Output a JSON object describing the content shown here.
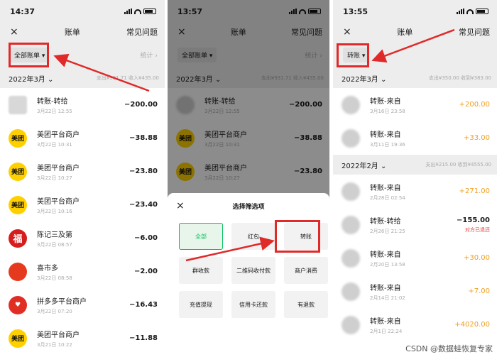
{
  "colors": {
    "accent_red": "#e02a2a",
    "wechat_green": "#07c160",
    "income_orange": "#f0a020"
  },
  "phone1": {
    "status_time": "14:37",
    "nav": {
      "close_icon": "×",
      "title": "账单",
      "faq": "常见问题"
    },
    "filter": {
      "label": "全部账单 ▾",
      "stats": "统计 ›"
    },
    "month": {
      "label": "2022年3月 ⌄",
      "summary": "支出¥931.71  收入¥435.00"
    },
    "rows": [
      {
        "icon": "blurred-avatar",
        "avatar_text": "",
        "name": "转账-转给",
        "date": "3月22日 12:55",
        "amount": "−200.00"
      },
      {
        "icon": "meituan-logo",
        "avatar_text": "美团",
        "name": "美团平台商户",
        "date": "3月22日 10:31",
        "amount": "−38.88"
      },
      {
        "icon": "meituan-logo",
        "avatar_text": "美团",
        "name": "美团平台商户",
        "date": "3月22日 10:27",
        "amount": "−23.80"
      },
      {
        "icon": "meituan-logo",
        "avatar_text": "美团",
        "name": "美团平台商户",
        "date": "3月22日 10:16",
        "amount": "−23.40"
      },
      {
        "icon": "fu-logo",
        "avatar_text": "福",
        "name": "陈记三及第",
        "date": "3月22日 08:57",
        "amount": "−6.00"
      },
      {
        "icon": "tomato-logo",
        "avatar_text": "",
        "name": "喜市多",
        "date": "3月22日 08:58",
        "amount": "−2.00"
      },
      {
        "icon": "pinduoduo-logo",
        "avatar_text": "♥",
        "name": "拼多多平台商户",
        "date": "3月22日 07:20",
        "amount": "−16.43"
      },
      {
        "icon": "meituan-logo",
        "avatar_text": "美团",
        "name": "美团平台商户",
        "date": "3月21日 10:22",
        "amount": "−11.88"
      }
    ]
  },
  "phone2": {
    "status_time": "13:57",
    "nav": {
      "close_icon": "×",
      "title": "账单",
      "faq": "常见问题"
    },
    "filter": {
      "label": "全部账单 ▾",
      "stats": "统计 ›"
    },
    "month": {
      "label": "2022年3月 ⌄",
      "summary": "支出¥931.71  收入¥435.00"
    },
    "rows": [
      {
        "icon": "person-avatar",
        "avatar_text": "",
        "name": "转账-转给",
        "date": "3月22日 12:55",
        "amount": "−200.00"
      },
      {
        "icon": "meituan-logo",
        "avatar_text": "美团",
        "name": "美团平台商户",
        "date": "3月22日 10:31",
        "amount": "−38.88"
      },
      {
        "icon": "meituan-logo",
        "avatar_text": "美团",
        "name": "美团平台商户",
        "date": "3月22日 10:27",
        "amount": "−23.80"
      }
    ],
    "sheet": {
      "close_icon": "×",
      "title": "选择筛选项",
      "options": [
        "全部",
        "红包",
        "转账",
        "群收款",
        "二维码收付款",
        "商户消费",
        "充值提现",
        "信用卡还款",
        "有退款"
      ]
    }
  },
  "phone3": {
    "status_time": "13:55",
    "nav": {
      "close_icon": "×",
      "title": "账单",
      "faq": "常见问题"
    },
    "filter": {
      "label": "转账 ▾"
    },
    "months": [
      {
        "label": "2022年3月 ⌄",
        "summary": "支出¥350.00  收到¥383.00",
        "rows": [
          {
            "name": "转账-来自",
            "date": "3月16日 23:58",
            "amount": "+200.00"
          },
          {
            "name": "转账-来自",
            "date": "3月11日 19:36",
            "amount": "+33.00"
          }
        ]
      },
      {
        "label": "2022年2月 ⌄",
        "summary": "支出¥215.00  收到¥4555.00",
        "rows": [
          {
            "name": "转账-来自",
            "date": "2月28日 02:54",
            "amount": "+271.00",
            "note": ""
          },
          {
            "name": "转账-转给",
            "date": "2月26日 21:25",
            "amount": "−155.00",
            "note": "对方已退还"
          },
          {
            "name": "转账-来自",
            "date": "2月20日 13:58",
            "amount": "+30.00",
            "note": ""
          },
          {
            "name": "转账-来自",
            "date": "2月14日 21:02",
            "amount": "+7.00",
            "note": ""
          },
          {
            "name": "转账-来自",
            "date": "2月1日 22:24",
            "amount": "+4020.00",
            "note": ""
          }
        ]
      }
    ]
  },
  "watermark": "CSDN @数据蛙恢复专家"
}
